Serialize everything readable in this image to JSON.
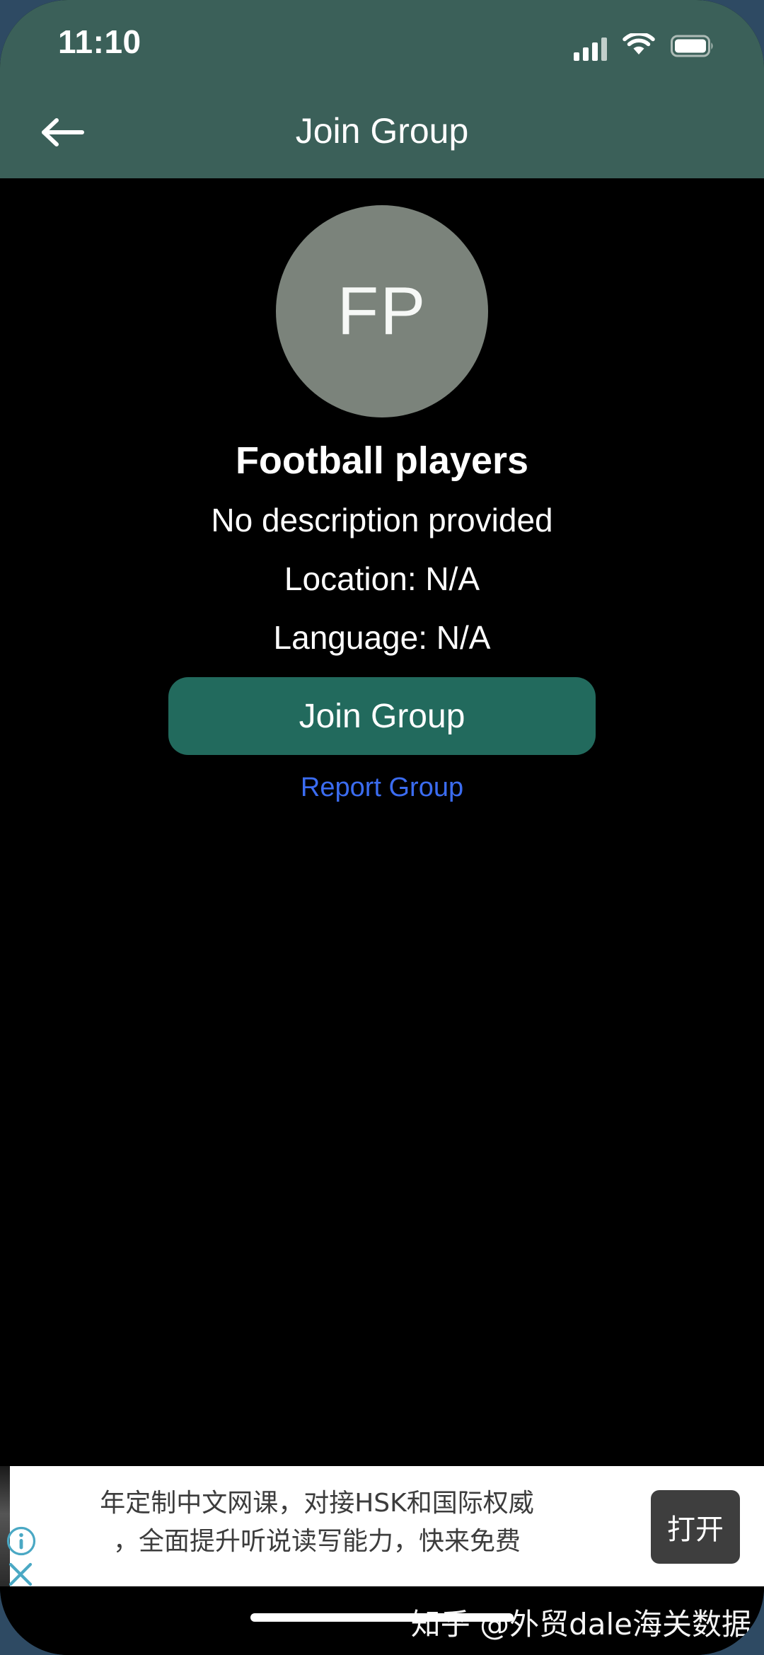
{
  "status_bar": {
    "time": "11:10",
    "signal_icon": "signal-bars-icon",
    "wifi_icon": "wifi-icon",
    "battery_icon": "battery-full-icon"
  },
  "header": {
    "back_icon": "back-arrow-icon",
    "title": "Join Group",
    "background_color": "#3b6059"
  },
  "group": {
    "avatar_initials": "FP",
    "avatar_color": "#7b837b",
    "name": "Football players",
    "description": "No description provided",
    "location": "Location: N/A",
    "language": "Language: N/A"
  },
  "actions": {
    "join_label": "Join Group",
    "join_color": "#226a5d",
    "report_label": "Report Group",
    "report_color": "#3b6cf0"
  },
  "ad": {
    "text_line_1": "年定制中文网课，对接HSK和国际权威",
    "text_line_2": "，全面提升听说读写能力，快来免费",
    "open_label": "打开",
    "info_icon": "info-circle-icon",
    "close_icon": "close-x-icon",
    "icon_color": "#4aa8c4"
  },
  "bottom": {
    "watermark": "知乎 @外贸dale海关数据",
    "home_indicator": "home-indicator"
  }
}
